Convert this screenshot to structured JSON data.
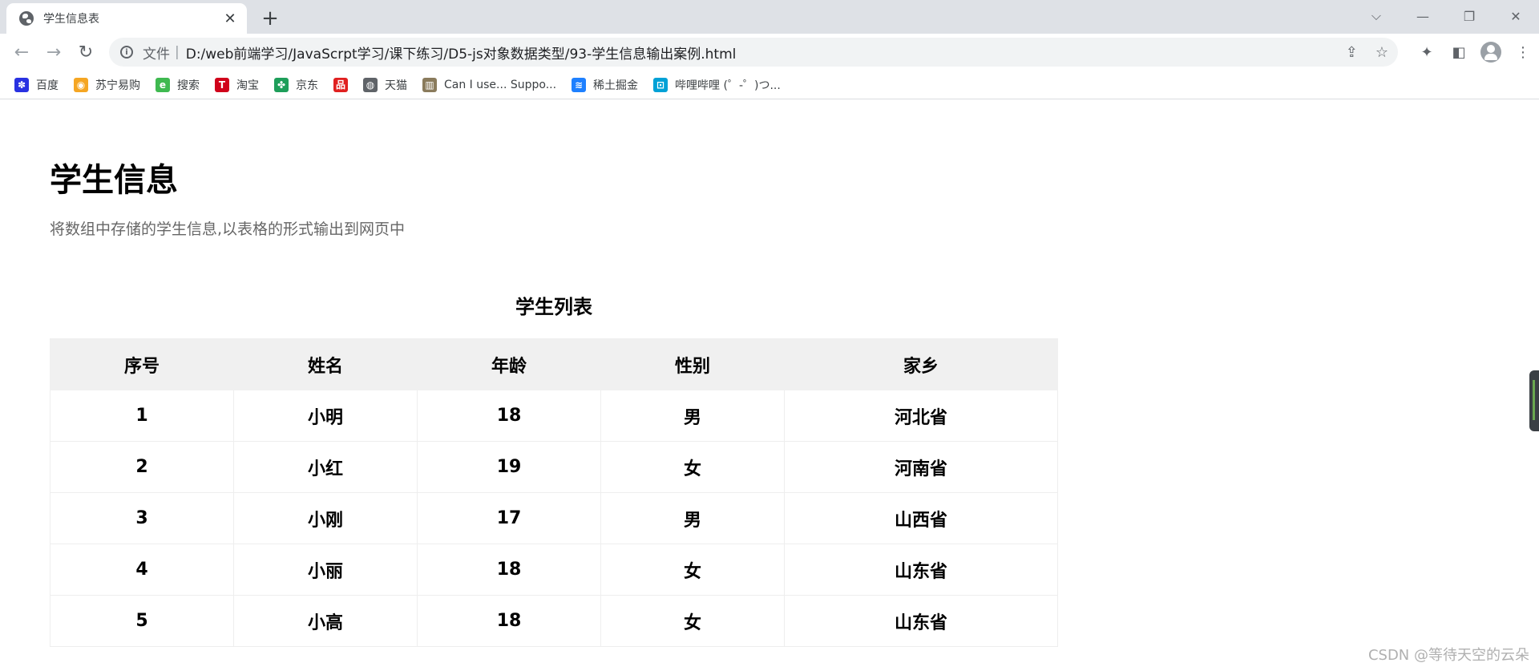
{
  "browser": {
    "tab_title": "学生信息表",
    "tab_close": "✕",
    "new_tab": "+",
    "window_controls": [
      "⌵",
      "—",
      "❐",
      "✕"
    ],
    "nav": {
      "back": "←",
      "forward": "→",
      "reload": "↻"
    },
    "address_scheme": "文件",
    "address_separator": "|",
    "address_url": "D:/web前端学习/JavaScrpt学习/课下练习/D5-js对象数据类型/93-学生信息输出案例.html",
    "omnibox_actions": {
      "share": "⇪",
      "bookmark": "☆"
    },
    "toolbar_actions": {
      "extensions": "✦",
      "side_panel": "◧",
      "menu": "⋮"
    }
  },
  "bookmarks": [
    {
      "label": "百度",
      "icon": "paw-icon",
      "color": "#2932e1",
      "glyph": "✽"
    },
    {
      "label": "苏宁易购",
      "icon": "lion-icon",
      "color": "#f5a623",
      "glyph": "◉"
    },
    {
      "label": "搜索",
      "icon": "browser-e-icon",
      "color": "#3fb950",
      "glyph": "e"
    },
    {
      "label": "淘宝",
      "icon": "taobao-t-icon",
      "color": "#d0021b",
      "glyph": "T"
    },
    {
      "label": "京东",
      "icon": "puzzle-icon",
      "color": "#1e9e5a",
      "glyph": "✤"
    },
    {
      "label": "",
      "icon": "grid-icon",
      "color": "#e02020",
      "glyph": "品"
    },
    {
      "label": "天猫",
      "icon": "globe-icon",
      "color": "#5f6368",
      "glyph": "◍"
    },
    {
      "label": "Can I use... Suppo...",
      "icon": "caniuse-icon",
      "color": "#8a7b5c",
      "glyph": "▥"
    },
    {
      "label": "稀土掘金",
      "icon": "juejin-icon",
      "color": "#1e80ff",
      "glyph": "≋"
    },
    {
      "label": "哔哩哔哩 (゜-゜)つ...",
      "icon": "bilibili-tv-icon",
      "color": "#00a1d6",
      "glyph": "⊡"
    }
  ],
  "page": {
    "title": "学生信息",
    "description": "将数组中存储的学生信息,以表格的形式输出到网页中",
    "table": {
      "caption": "学生列表",
      "headers": [
        "序号",
        "姓名",
        "年龄",
        "性别",
        "家乡"
      ],
      "rows": [
        [
          "1",
          "小明",
          "18",
          "男",
          "河北省"
        ],
        [
          "2",
          "小红",
          "19",
          "女",
          "河南省"
        ],
        [
          "3",
          "小刚",
          "17",
          "男",
          "山西省"
        ],
        [
          "4",
          "小丽",
          "18",
          "女",
          "山东省"
        ],
        [
          "5",
          "小高",
          "18",
          "女",
          "山东省"
        ]
      ]
    }
  },
  "watermark": "CSDN @等待天空的云朵"
}
